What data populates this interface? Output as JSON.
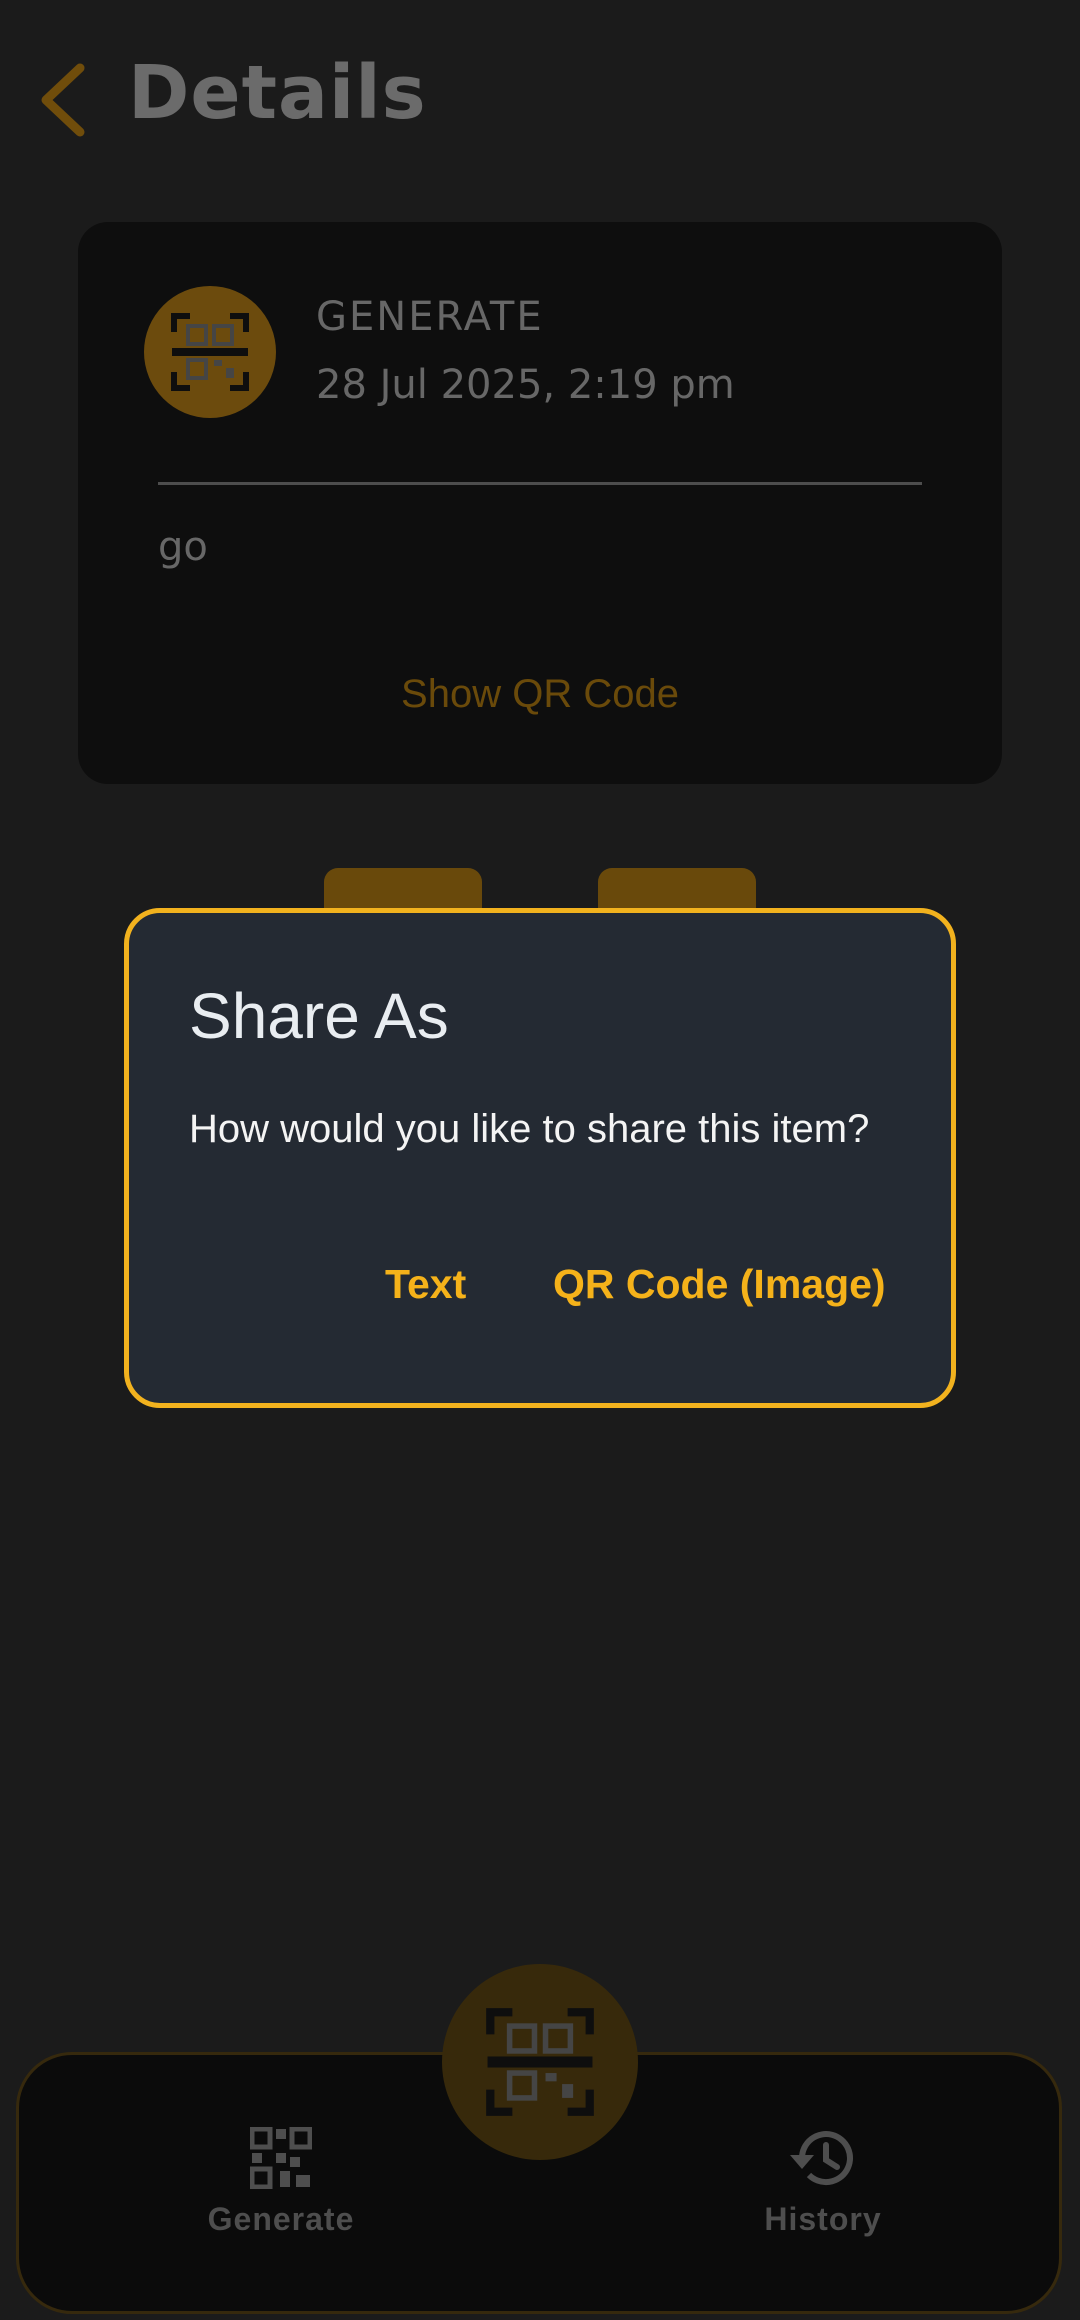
{
  "header": {
    "title": "Details",
    "back_icon": "chevron-left-icon"
  },
  "card": {
    "type": "GENERATE",
    "date": "28 Jul 2025, 2:19 pm",
    "content": "go",
    "show_qr_label": "Show QR Code",
    "icon": "qr-scan-icon"
  },
  "dialog": {
    "title": "Share As",
    "message": "How would you like to share this item?",
    "text_button": "Text",
    "image_button": "QR Code (Image)"
  },
  "bottom_nav": {
    "generate_label": "Generate",
    "history_label": "History",
    "fab_icon": "qr-scan-icon"
  },
  "colors": {
    "accent": "#f5b21a",
    "background": "#242424",
    "dialog_bg": "#242a33",
    "card_bg": "#1c1c1c"
  }
}
